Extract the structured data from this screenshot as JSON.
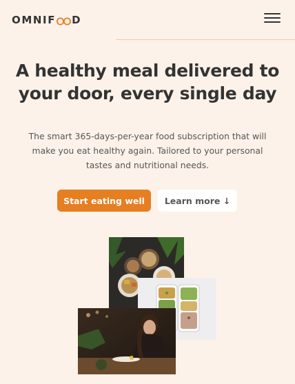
{
  "header": {
    "logo_text_left": "OMNIF",
    "logo_text_right": "D",
    "menu_icon": "hamburger-menu-icon"
  },
  "hero": {
    "title": "A healthy meal delivered to your door, every single day",
    "description": "The smart 365-days-per-year food subscription that will make you eat healthy again. Tailored to your personal tastes and nutritional needs.",
    "primary_button": "Start eating well",
    "secondary_button": "Learn more ↓"
  },
  "colors": {
    "background": "#fdf2e9",
    "accent": "#e67e22",
    "text": "#333333"
  }
}
